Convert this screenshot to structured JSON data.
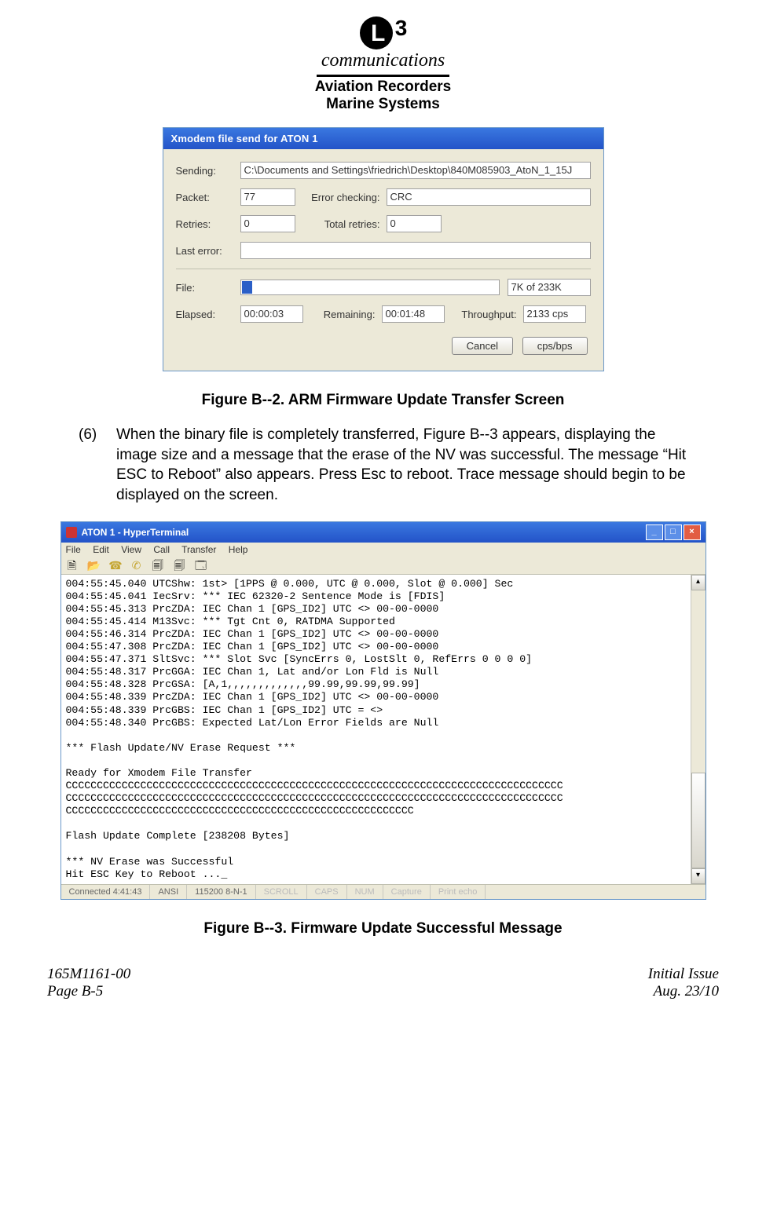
{
  "header": {
    "logo_super": "3",
    "communications": "communications",
    "sub1": "Aviation Recorders",
    "sub2": "Marine Systems"
  },
  "dialog": {
    "title": "Xmodem file send for ATON 1",
    "labels": {
      "sending": "Sending:",
      "packet": "Packet:",
      "error_checking": "Error checking:",
      "retries": "Retries:",
      "total_retries": "Total retries:",
      "last_error": "Last error:",
      "file": "File:",
      "elapsed": "Elapsed:",
      "remaining": "Remaining:",
      "throughput": "Throughput:"
    },
    "values": {
      "sending": "C:\\Documents and Settings\\friedrich\\Desktop\\840M085903_AtoN_1_15J",
      "packet": "77",
      "error_checking": "CRC",
      "retries": "0",
      "total_retries": "0",
      "last_error": "",
      "file_progress": "7K of 233K",
      "elapsed": "00:00:03",
      "remaining": "00:01:48",
      "throughput": "2133 cps"
    },
    "buttons": {
      "cancel": "Cancel",
      "cpsbps": "cps/bps"
    }
  },
  "caption1": "Figure B--2.  ARM Firmware Update Transfer Screen",
  "para": {
    "num": "(6)",
    "text": "When the binary file is completely transferred, Figure B--3 appears, displaying the image size and a message that the erase of the NV was successful. The message “Hit ESC to Reboot” also appears. Press Esc to reboot. Trace message should begin to be displayed on the screen."
  },
  "terminal": {
    "title": "ATON 1 - HyperTerminal",
    "menu": [
      "File",
      "Edit",
      "View",
      "Call",
      "Transfer",
      "Help"
    ],
    "body": "004:55:45.040 UTCShw: 1st> [1PPS @ 0.000, UTC @ 0.000, Slot @ 0.000] Sec\n004:55:45.041 IecSrv: *** IEC 62320-2 Sentence Mode is [FDIS]\n004:55:45.313 PrcZDA: IEC Chan 1 [GPS_ID2] UTC <> 00-00-0000\n004:55:45.414 M13Svc: *** Tgt Cnt 0, RATDMA Supported\n004:55:46.314 PrcZDA: IEC Chan 1 [GPS_ID2] UTC <> 00-00-0000\n004:55:47.308 PrcZDA: IEC Chan 1 [GPS_ID2] UTC <> 00-00-0000\n004:55:47.371 SltSvc: *** Slot Svc [SyncErrs 0, LostSlt 0, RefErrs 0 0 0 0]\n004:55:48.317 PrcGGA: IEC Chan 1, Lat and/or Lon Fld is Null\n004:55:48.328 PrcGSA: [A,1,,,,,,,,,,,,,99.99,99.99,99.99]\n004:55:48.339 PrcZDA: IEC Chan 1 [GPS_ID2] UTC <> 00-00-0000\n004:55:48.339 PrcGBS: IEC Chan 1 [GPS_ID2] UTC = <>\n004:55:48.340 PrcGBS: Expected Lat/Lon Error Fields are Null\n\n*** Flash Update/NV Erase Request ***\n\nReady for Xmodem File Transfer\nCCCCCCCCCCCCCCCCCCCCCCCCCCCCCCCCCCCCCCCCCCCCCCCCCCCCCCCCCCCCCCCCCCCCCCCCCCCCCCCC\nCCCCCCCCCCCCCCCCCCCCCCCCCCCCCCCCCCCCCCCCCCCCCCCCCCCCCCCCCCCCCCCCCCCCCCCCCCCCCCCC\nCCCCCCCCCCCCCCCCCCCCCCCCCCCCCCCCCCCCCCCCCCCCCCCCCCCCCCCC\n\nFlash Update Complete [238208 Bytes]\n\n*** NV Erase was Successful\nHit ESC Key to Reboot ..._",
    "status": {
      "connected": "Connected 4:41:43",
      "encoding": "ANSI",
      "baud": "115200 8-N-1",
      "scroll": "SCROLL",
      "caps": "CAPS",
      "num": "NUM",
      "capture": "Capture",
      "printecho": "Print echo"
    }
  },
  "caption2": "Figure B--3.  Firmware Update Successful Message",
  "footer": {
    "left1": "165M1161-00",
    "left2": "Page B-5",
    "right1": "Initial Issue",
    "right2": "Aug. 23/10"
  }
}
